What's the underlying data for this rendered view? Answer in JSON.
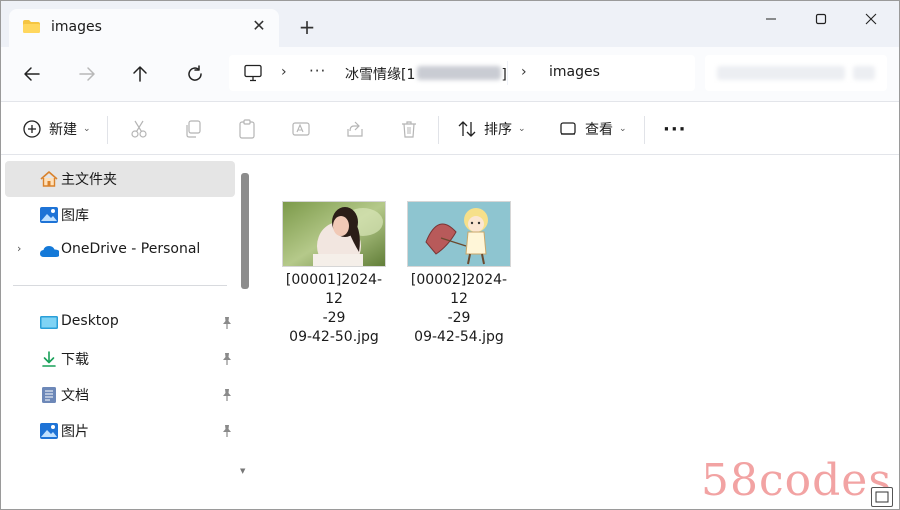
{
  "tab": {
    "title": "images",
    "close": "✕",
    "new_tab": "+"
  },
  "address": {
    "segment_parent": "冰雪情缘[1",
    "segment_parent_suffix": "]",
    "segment_current": "images",
    "overflow": "···"
  },
  "toolbar": {
    "new_label": "新建",
    "sort_label": "排序",
    "view_label": "查看",
    "more": "···"
  },
  "sidebar": {
    "items": [
      {
        "label": "主文件夹",
        "icon": "home-icon"
      },
      {
        "label": "图库",
        "icon": "gallery-icon"
      },
      {
        "label": "OneDrive - Personal",
        "icon": "onedrive-icon"
      },
      {
        "label": "Desktop",
        "icon": "desktop-icon"
      },
      {
        "label": "下载",
        "icon": "download-icon"
      },
      {
        "label": "文档",
        "icon": "document-icon"
      },
      {
        "label": "图片",
        "icon": "pictures-icon"
      }
    ]
  },
  "files": [
    {
      "line1": "[00001]2024-12",
      "line2": "-29",
      "line3": "09-42-50.jpg"
    },
    {
      "line1": "[00002]2024-12",
      "line2": "-29",
      "line3": "09-42-54.jpg"
    }
  ],
  "watermark": "58codes",
  "colors": {
    "accent": "#0067c0",
    "folder": "#f5c542",
    "selected_bg": "#e5e5e5",
    "watermark": "#f2a3a3"
  }
}
